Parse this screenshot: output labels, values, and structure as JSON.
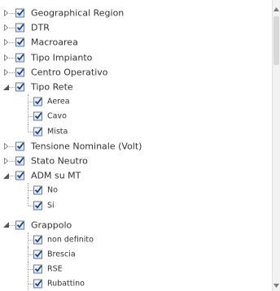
{
  "tree": {
    "items": [
      {
        "label": "Geographical Region",
        "level": 0,
        "expanded": false,
        "checked": true
      },
      {
        "label": "DTR",
        "level": 0,
        "expanded": false,
        "checked": true
      },
      {
        "label": "Macroarea",
        "level": 0,
        "expanded": false,
        "checked": true
      },
      {
        "label": "Tipo Impianto",
        "level": 0,
        "expanded": false,
        "checked": true
      },
      {
        "label": "Centro Operativo",
        "level": 0,
        "expanded": false,
        "checked": true
      },
      {
        "label": "Tipo Rete",
        "level": 0,
        "expanded": true,
        "checked": true
      },
      {
        "label": "Aerea",
        "level": 1,
        "checked": true
      },
      {
        "label": "Cavo",
        "level": 1,
        "checked": true
      },
      {
        "label": "Mista",
        "level": 1,
        "checked": true,
        "last": true
      },
      {
        "label": "Tensione Nominale (Volt)",
        "level": 0,
        "expanded": false,
        "checked": true
      },
      {
        "label": "Stato Neutro",
        "level": 0,
        "expanded": false,
        "checked": true
      },
      {
        "label": "ADM su MT",
        "level": 0,
        "expanded": true,
        "checked": true
      },
      {
        "label": "No",
        "level": 1,
        "checked": true
      },
      {
        "label": "Si",
        "level": 1,
        "checked": true,
        "last": true
      },
      {
        "label": "",
        "level": "spacer"
      },
      {
        "label": "Grappolo",
        "level": 0,
        "expanded": true,
        "checked": true
      },
      {
        "label": "non definito",
        "level": 1,
        "checked": true
      },
      {
        "label": "Brescia",
        "level": 1,
        "checked": true
      },
      {
        "label": "RSE",
        "level": 1,
        "checked": true
      },
      {
        "label": "Rubattino",
        "level": 1,
        "checked": true
      }
    ]
  },
  "icons": {
    "collapsed": "triangle-right-icon",
    "expanded": "triangle-down-icon",
    "check": "checkmark-icon"
  },
  "colors": {
    "checkbox_border": "#5f79a8",
    "check_mark": "#1f3f8a",
    "text": "#333333",
    "guide": "#9a9a9a"
  }
}
